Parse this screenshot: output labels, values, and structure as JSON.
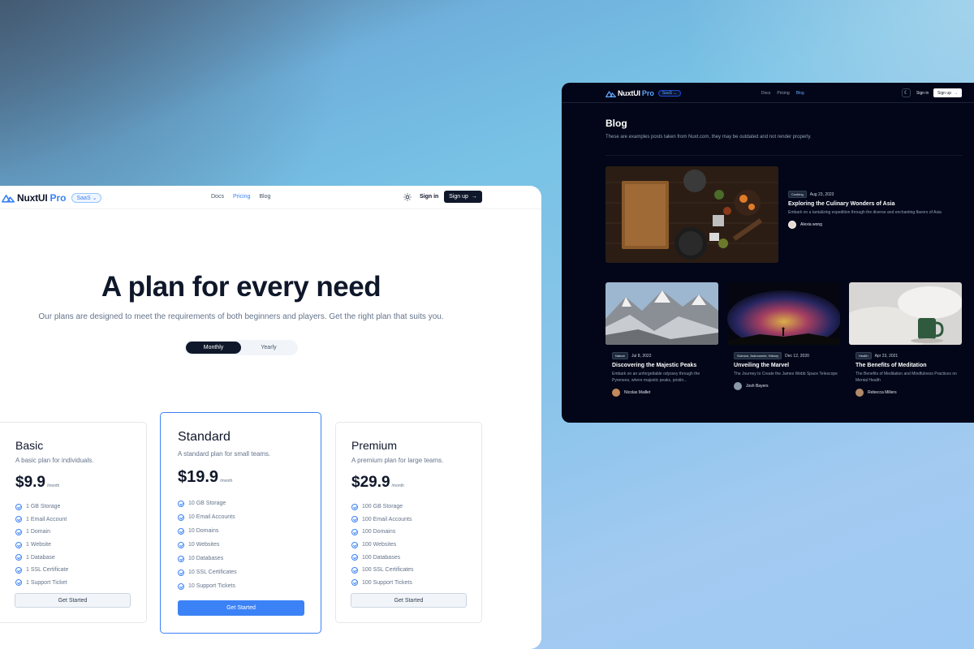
{
  "colors": {
    "accent": "#3b82f6",
    "dark_bg": "#020618",
    "text_dark": "#0f172a"
  },
  "pricing_window": {
    "logo": {
      "text": "NuxtUI",
      "pro": "Pro",
      "badge": "SaaS"
    },
    "nav": [
      "Docs",
      "Pricing",
      "Blog"
    ],
    "nav_active": "Pricing",
    "signin": "Sign in",
    "signup": "Sign up",
    "hero_title": "A plan for every need",
    "hero_subtitle": "Our plans are designed to meet the requirements of both beginners and players. Get the right plan that suits you.",
    "toggle": {
      "monthly": "Monthly",
      "yearly": "Yearly",
      "selected": "Monthly"
    },
    "plans": [
      {
        "name": "Basic",
        "description": "A basic plan for individuals.",
        "price": "$9.9",
        "period": "/month",
        "features": [
          "1 GB Storage",
          "1 Email Account",
          "1 Domain",
          "1 Website",
          "1 Database",
          "1 SSL Certificate",
          "1 Support Ticket"
        ],
        "button": "Get Started"
      },
      {
        "name": "Standard",
        "description": "A standard plan for small teams.",
        "price": "$19.9",
        "period": "/month",
        "features": [
          "10 GB Storage",
          "10 Email Accounts",
          "10 Domains",
          "10 Websites",
          "10 Databases",
          "10 SSL Certificates",
          "10 Support Tickets"
        ],
        "button": "Get Started"
      },
      {
        "name": "Premium",
        "description": "A premium plan for large teams.",
        "price": "$29.9",
        "period": "/month",
        "features": [
          "100 GB Storage",
          "100 Email Accounts",
          "100 Domains",
          "100 Websites",
          "100 Databases",
          "100 SSL Certificates",
          "100 Support Tickets"
        ],
        "button": "Get Started"
      }
    ]
  },
  "blog_window": {
    "logo": {
      "text": "NuxtUI",
      "pro": "Pro",
      "badge": "SaaS"
    },
    "nav": [
      "Docs",
      "Pricing",
      "Blog"
    ],
    "nav_active": "Blog",
    "signin": "Sign in",
    "signup": "Sign up",
    "title": "Blog",
    "subtitle": "These are examples posts taken from Nuxt.com, they may be outdated and not render properly.",
    "featured": {
      "tag": "Cooking",
      "date": "Aug 23, 2023",
      "title": "Exploring the Culinary Wonders of Asia",
      "description": "Embark on a tantalizing expedition through the diverse and enchanting flavors of Asia",
      "author": "Alexia wong"
    },
    "posts": [
      {
        "tag": "Nature",
        "date": "Jul 8, 2022",
        "title": "Discovering the Majestic Peaks",
        "description": "Embark on an unforgettable odyssey through the Pyrenees, where majestic peaks, pristin...",
        "author": "Nicolas Maillet"
      },
      {
        "tag": "Science, Astronomie, History",
        "date": "Dec 12, 2020",
        "title": "Unveiling the Marvel",
        "description": "The Journey to Create the James Webb Space Telescope",
        "author": "Josh Bayers"
      },
      {
        "tag": "Health",
        "date": "Apr 23, 2021",
        "title": "The Benefits of Meditation",
        "description": "The Benefits of Meditation and Mindfulness Practices on Mental Health",
        "author": "Rebecca Millers"
      }
    ]
  }
}
